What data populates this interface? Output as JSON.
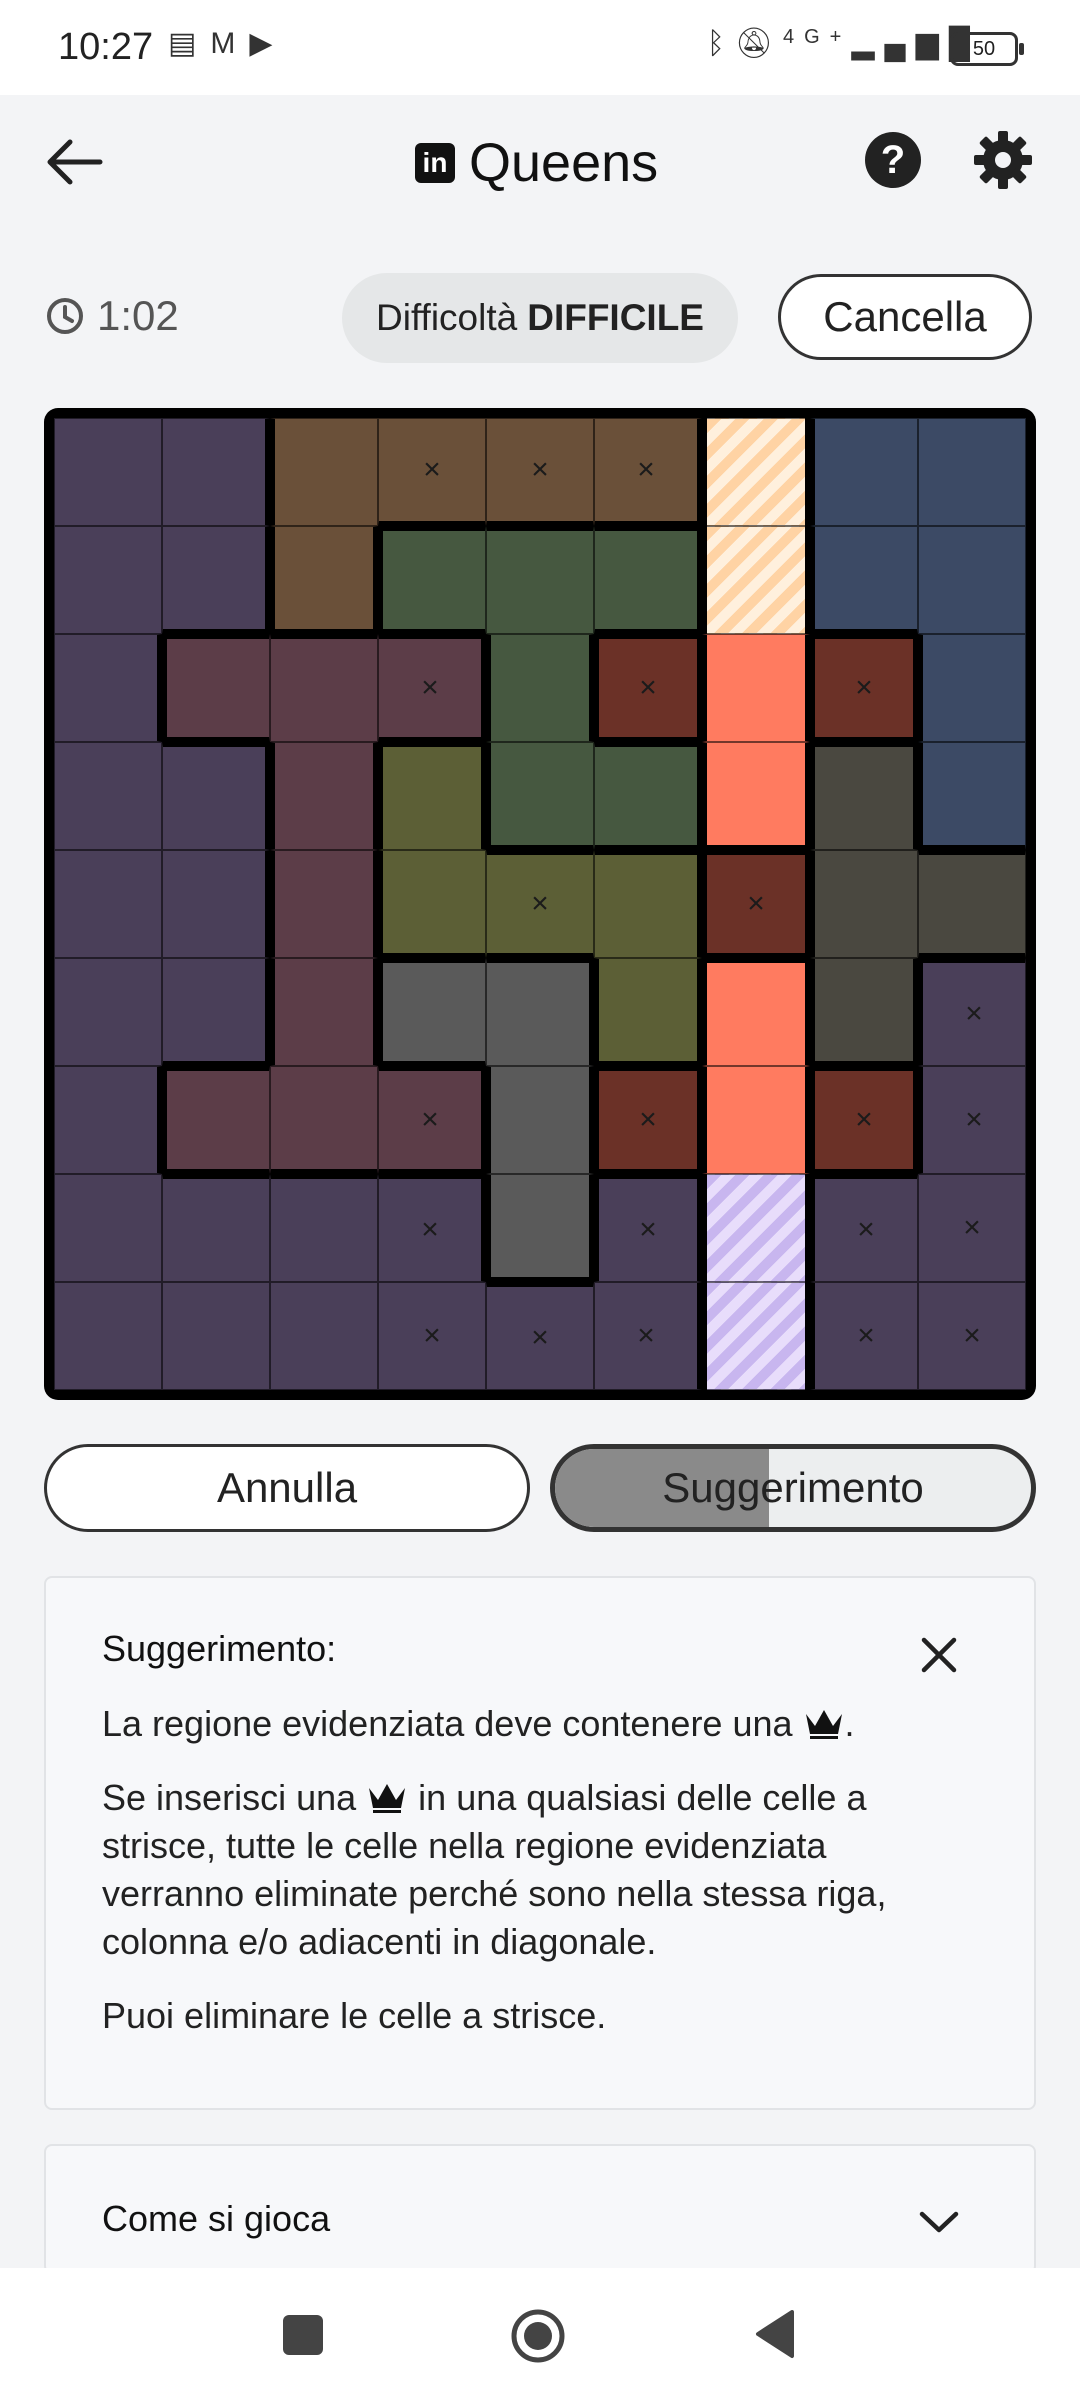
{
  "status_bar": {
    "time": "10:27",
    "left_icons": [
      "vpn-icon",
      "gmail-icon",
      "youtube-icon"
    ],
    "right_icons": [
      "bluetooth-icon",
      "mute-icon",
      "signal-4g-icon"
    ],
    "network": "4G+",
    "battery": "50"
  },
  "header": {
    "title": "Queens",
    "logo_text": "in",
    "help_label": "?"
  },
  "info": {
    "timer": "1:02",
    "difficulty_prefix": "Difficoltà",
    "difficulty_value": "DIFFICILE",
    "clear_label": "Cancella"
  },
  "board": {
    "size": 9,
    "colors": {
      "purple": "#4a3f59",
      "brown": "#6a5039",
      "navy": "#3c4a65",
      "green": "#465840",
      "maroon": "#5c3d48",
      "olive": "#5c5f36",
      "red": "#6b3127",
      "salmon": "#ff7b60",
      "gray": "#5a5a5a",
      "taupe": "#4a4840"
    },
    "stripe_colors": {
      "peach": [
        "#ffd3a4",
        "#fff0dd"
      ],
      "lavender": [
        "#c8b6ef",
        "#e8ddfb"
      ]
    },
    "regions": [
      [
        "purple",
        "purple",
        "brown",
        "brown",
        "brown",
        "brown",
        "salmon",
        "navy",
        "navy"
      ],
      [
        "purple",
        "purple",
        "brown",
        "green",
        "green",
        "green",
        "salmon",
        "navy",
        "navy"
      ],
      [
        "purple",
        "maroon",
        "maroon",
        "maroon",
        "green",
        "red",
        "salmon",
        "red",
        "navy"
      ],
      [
        "purple",
        "purple",
        "maroon",
        "olive",
        "green",
        "green",
        "salmon",
        "taupe",
        "navy"
      ],
      [
        "purple",
        "purple",
        "maroon",
        "olive",
        "olive",
        "olive",
        "red",
        "taupe",
        "taupe"
      ],
      [
        "purple",
        "purple",
        "maroon",
        "gray",
        "gray",
        "olive",
        "salmon",
        "taupe",
        "purple"
      ],
      [
        "purple",
        "maroon",
        "maroon",
        "maroon",
        "gray",
        "red",
        "salmon",
        "red",
        "purple"
      ],
      [
        "purple",
        "purple",
        "purple",
        "purple",
        "gray",
        "purple",
        "salmon",
        "purple",
        "purple"
      ],
      [
        "purple",
        "purple",
        "purple",
        "purple",
        "purple",
        "purple",
        "salmon",
        "purple",
        "purple"
      ]
    ],
    "fills": [
      [
        "purple",
        "purple",
        "brown",
        "brown",
        "brown",
        "brown",
        "peach",
        "navy",
        "navy"
      ],
      [
        "purple",
        "purple",
        "brown",
        "green",
        "green",
        "green",
        "peach",
        "navy",
        "navy"
      ],
      [
        "purple",
        "maroon",
        "maroon",
        "maroon",
        "green",
        "red",
        "salmon",
        "red",
        "navy"
      ],
      [
        "purple",
        "purple",
        "maroon",
        "olive",
        "green",
        "green",
        "salmon",
        "taupe",
        "navy"
      ],
      [
        "purple",
        "purple",
        "maroon",
        "olive",
        "olive",
        "olive",
        "red",
        "taupe",
        "taupe"
      ],
      [
        "purple",
        "purple",
        "maroon",
        "gray",
        "gray",
        "olive",
        "salmon",
        "taupe",
        "purple"
      ],
      [
        "purple",
        "maroon",
        "maroon",
        "maroon",
        "gray",
        "red",
        "salmon",
        "red",
        "purple"
      ],
      [
        "purple",
        "purple",
        "purple",
        "purple",
        "gray",
        "purple",
        "lavender",
        "purple",
        "purple"
      ],
      [
        "purple",
        "purple",
        "purple",
        "purple",
        "purple",
        "purple",
        "lavender",
        "purple",
        "purple"
      ]
    ],
    "marks": [
      [
        "",
        "",
        "",
        "×",
        "×",
        "×",
        "",
        "",
        ""
      ],
      [
        "",
        "",
        "",
        "",
        "",
        "",
        "",
        "",
        ""
      ],
      [
        "",
        "",
        "",
        "×",
        "",
        "×",
        "",
        "×",
        ""
      ],
      [
        "",
        "",
        "",
        "",
        "",
        "",
        "",
        "",
        ""
      ],
      [
        "",
        "",
        "",
        "",
        "×",
        "",
        "×",
        "",
        ""
      ],
      [
        "",
        "",
        "",
        "",
        "",
        "",
        "",
        "",
        "×"
      ],
      [
        "",
        "",
        "",
        "×",
        "",
        "×",
        "",
        "×",
        "×"
      ],
      [
        "",
        "",
        "",
        "×",
        "",
        "×",
        "",
        "×",
        "×"
      ],
      [
        "",
        "",
        "",
        "×",
        "×",
        "×",
        "",
        "×",
        "×"
      ]
    ]
  },
  "actions": {
    "undo_label": "Annulla",
    "hint_label": "Suggerimento",
    "hint_progress": 0.45
  },
  "hint_panel": {
    "title": "Suggerimento:",
    "line1_before": "La regione evidenziata deve contenere una",
    "line1_after": ".",
    "line2_before": "Se inserisci una",
    "line2_after": "in una qualsiasi delle celle a strisce, tutte le celle nella regione evidenziata verranno eliminate perché sono nella stessa riga, colonna e/o adiacenti in diagonale.",
    "line3": "Puoi eliminare le celle a strisce."
  },
  "howto": {
    "title": "Come si gioca"
  }
}
